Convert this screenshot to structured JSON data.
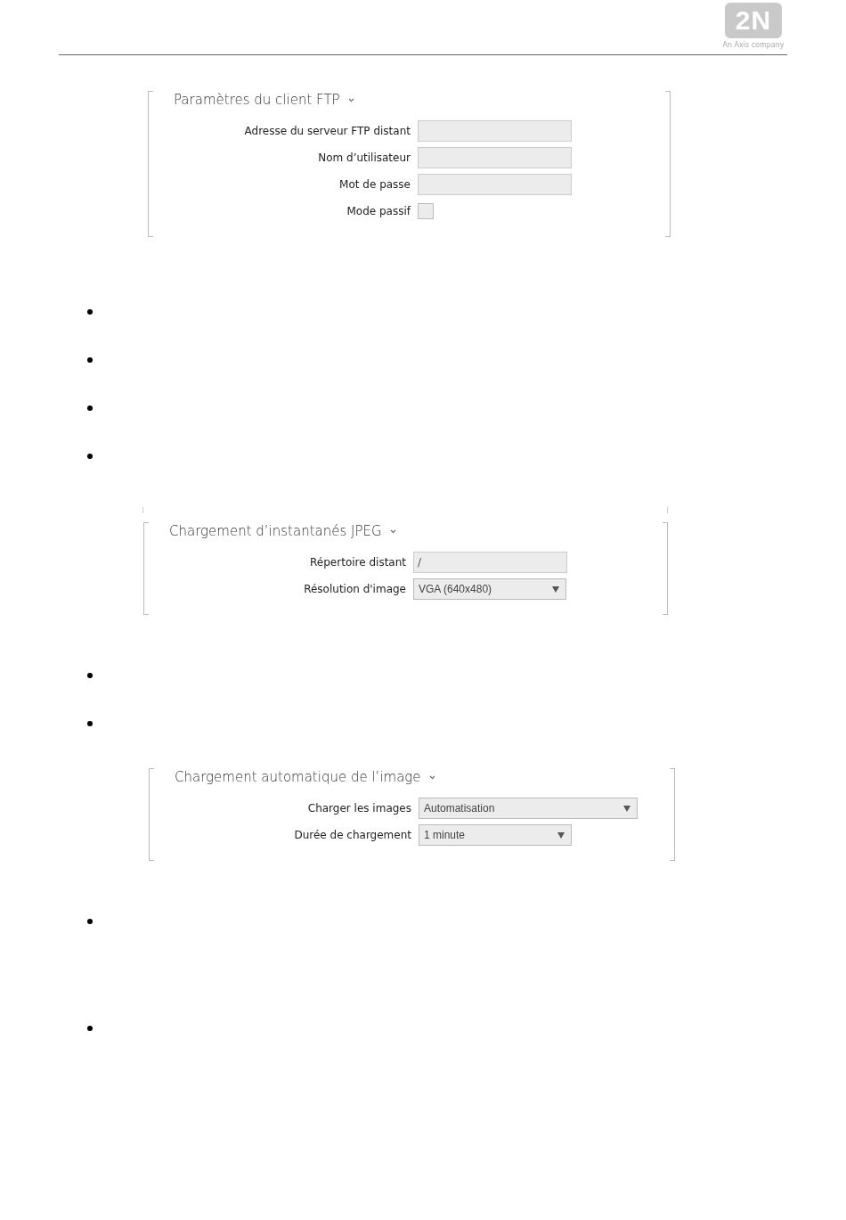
{
  "header": {
    "logo": "2N",
    "logo_tagline": "An Axis company"
  },
  "blocks": [
    {
      "kind": "section",
      "title": "Paramètres du client FTP",
      "fields": [
        {
          "kind": "text",
          "label": "Adresse du serveur FTP distant"
        },
        {
          "kind": "text",
          "label": "Nom d’utilisateur"
        },
        {
          "kind": "text",
          "label": "Mot de passe"
        },
        {
          "kind": "checkbox",
          "label": "Mode passif",
          "checked": false
        }
      ]
    },
    {
      "kind": "bullets",
      "items": [
        {
          "kind": "bullet"
        },
        {
          "kind": "bullet"
        },
        {
          "kind": "bullet"
        },
        {
          "kind": "bullet"
        }
      ]
    },
    {
      "kind": "frame_end"
    },
    {
      "kind": "section",
      "title": "Chargement d’instantanés JPEG",
      "fields": [
        {
          "kind": "text",
          "label": "Répertoire distant",
          "value": "/"
        },
        {
          "kind": "select",
          "label": "Résolution d'image",
          "value": "VGA (640x480)"
        }
      ]
    },
    {
      "kind": "bullets",
      "items": [
        {
          "kind": "bullet"
        },
        {
          "kind": "bullet"
        }
      ]
    },
    {
      "kind": "section",
      "title": "Chargement automatique de l’image",
      "fields": [
        {
          "kind": "select",
          "label": "Charger les images",
          "value": "Automatisation"
        },
        {
          "kind": "select",
          "label": "Durée de chargement",
          "value": "1 minute"
        }
      ]
    },
    {
      "kind": "bullets",
      "items": [
        {
          "kind": "bullet"
        },
        {
          "kind": "bullet"
        }
      ]
    }
  ]
}
